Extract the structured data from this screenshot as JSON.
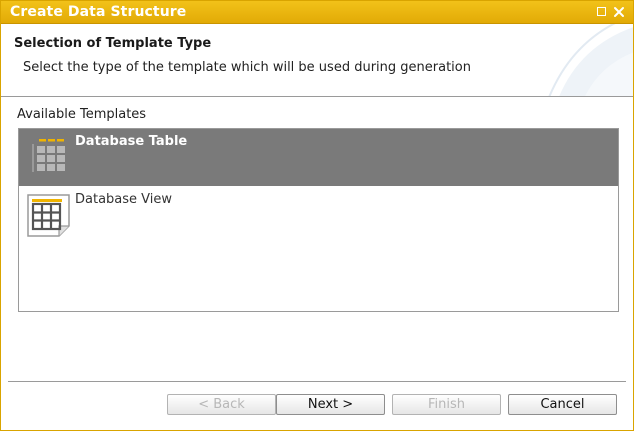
{
  "window": {
    "title": "Create Data Structure",
    "accent_color": "#e9b20e"
  },
  "titlebar_icons": [
    "maximize-icon",
    "close-icon"
  ],
  "header": {
    "title": "Selection of Template Type",
    "description": "Select the type of the template which will be used during generation"
  },
  "templates": {
    "label": "Available Templates",
    "items": [
      {
        "label": "Database Table",
        "icon": "database-table-icon",
        "selected": true
      },
      {
        "label": "Database View",
        "icon": "database-view-icon",
        "selected": false
      }
    ],
    "selected_color": "#7a7a7a"
  },
  "buttons": {
    "back": "< Back",
    "next": "Next >",
    "finish": "Finish",
    "cancel": "Cancel"
  }
}
